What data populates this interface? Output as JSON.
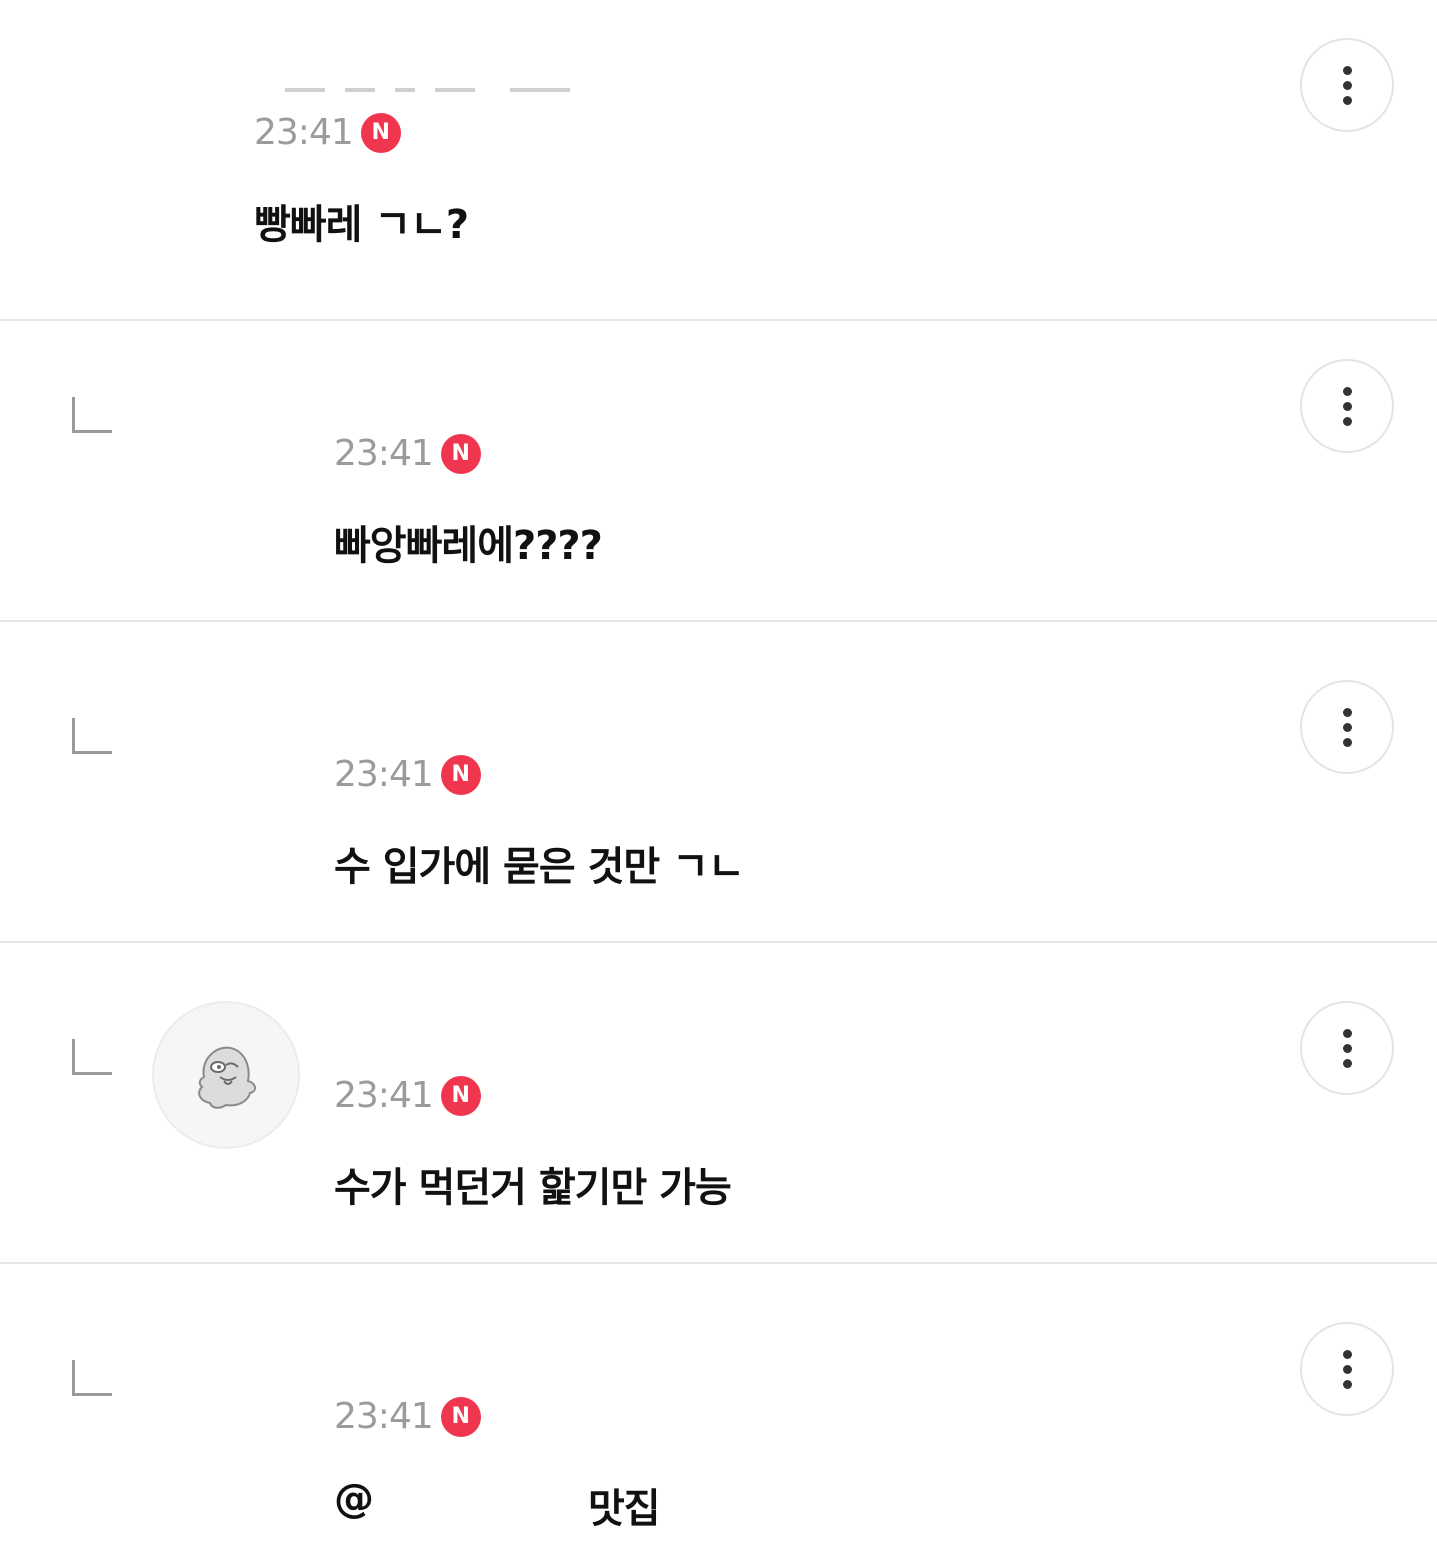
{
  "comments": [
    {
      "time": "23:41",
      "badge": "N",
      "text": "빵빠레 ㄱㄴ?",
      "is_reply": false,
      "avatar_icon": "avatar-icon"
    },
    {
      "time": "23:41",
      "badge": "N",
      "text": "빠앙빠레에????",
      "is_reply": true,
      "avatar_icon": "avatar-icon"
    },
    {
      "time": "23:41",
      "badge": "N",
      "text": "수 입가에 묻은 것만 ㄱㄴ",
      "is_reply": true,
      "avatar_icon": "avatar-icon"
    },
    {
      "time": "23:41",
      "badge": "N",
      "text": "수가 먹던거 핥기만 가능",
      "is_reply": true,
      "avatar_icon": "mascot-avatar-icon"
    },
    {
      "time": "23:41",
      "badge": "N",
      "mention": "@",
      "text": "맛집",
      "is_reply": true,
      "avatar_icon": "avatar-icon"
    }
  ],
  "colors": {
    "badge": "#f0364f",
    "time": "#9b9b9b",
    "divider": "#e6e6e6",
    "text": "#111111"
  },
  "icons": {
    "more": "more-vertical-icon",
    "reply": "reply-arrow-icon",
    "new": "new-badge-icon"
  }
}
